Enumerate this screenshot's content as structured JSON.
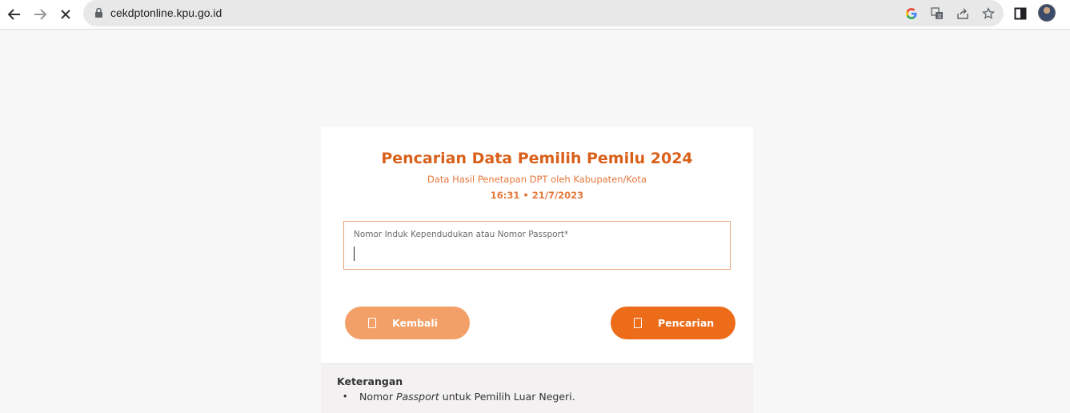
{
  "browser": {
    "url": "cekdptonline.kpu.go.id"
  },
  "card": {
    "title": "Pencarian Data Pemilih Pemilu 2024",
    "subtitle": "Data Hasil Penetapan DPT oleh Kabupaten/Kota",
    "timestamp": "16:31 • 21/7/2023",
    "nik_field": {
      "label": "Nomor Induk Kependudukan atau Nomor Passport*",
      "value": ""
    },
    "back_button": {
      "label": "Kembali"
    },
    "search_button": {
      "label": "Pencarian"
    }
  },
  "notes": {
    "title": "Keterangan",
    "item_prefix": "Nomor ",
    "item_italic": "Passport",
    "item_suffix": " untuk Pemilih Luar Negeri."
  },
  "colors": {
    "accent": "#ec6c1a",
    "accent_light": "#f3a068",
    "title": "#d9601a"
  }
}
